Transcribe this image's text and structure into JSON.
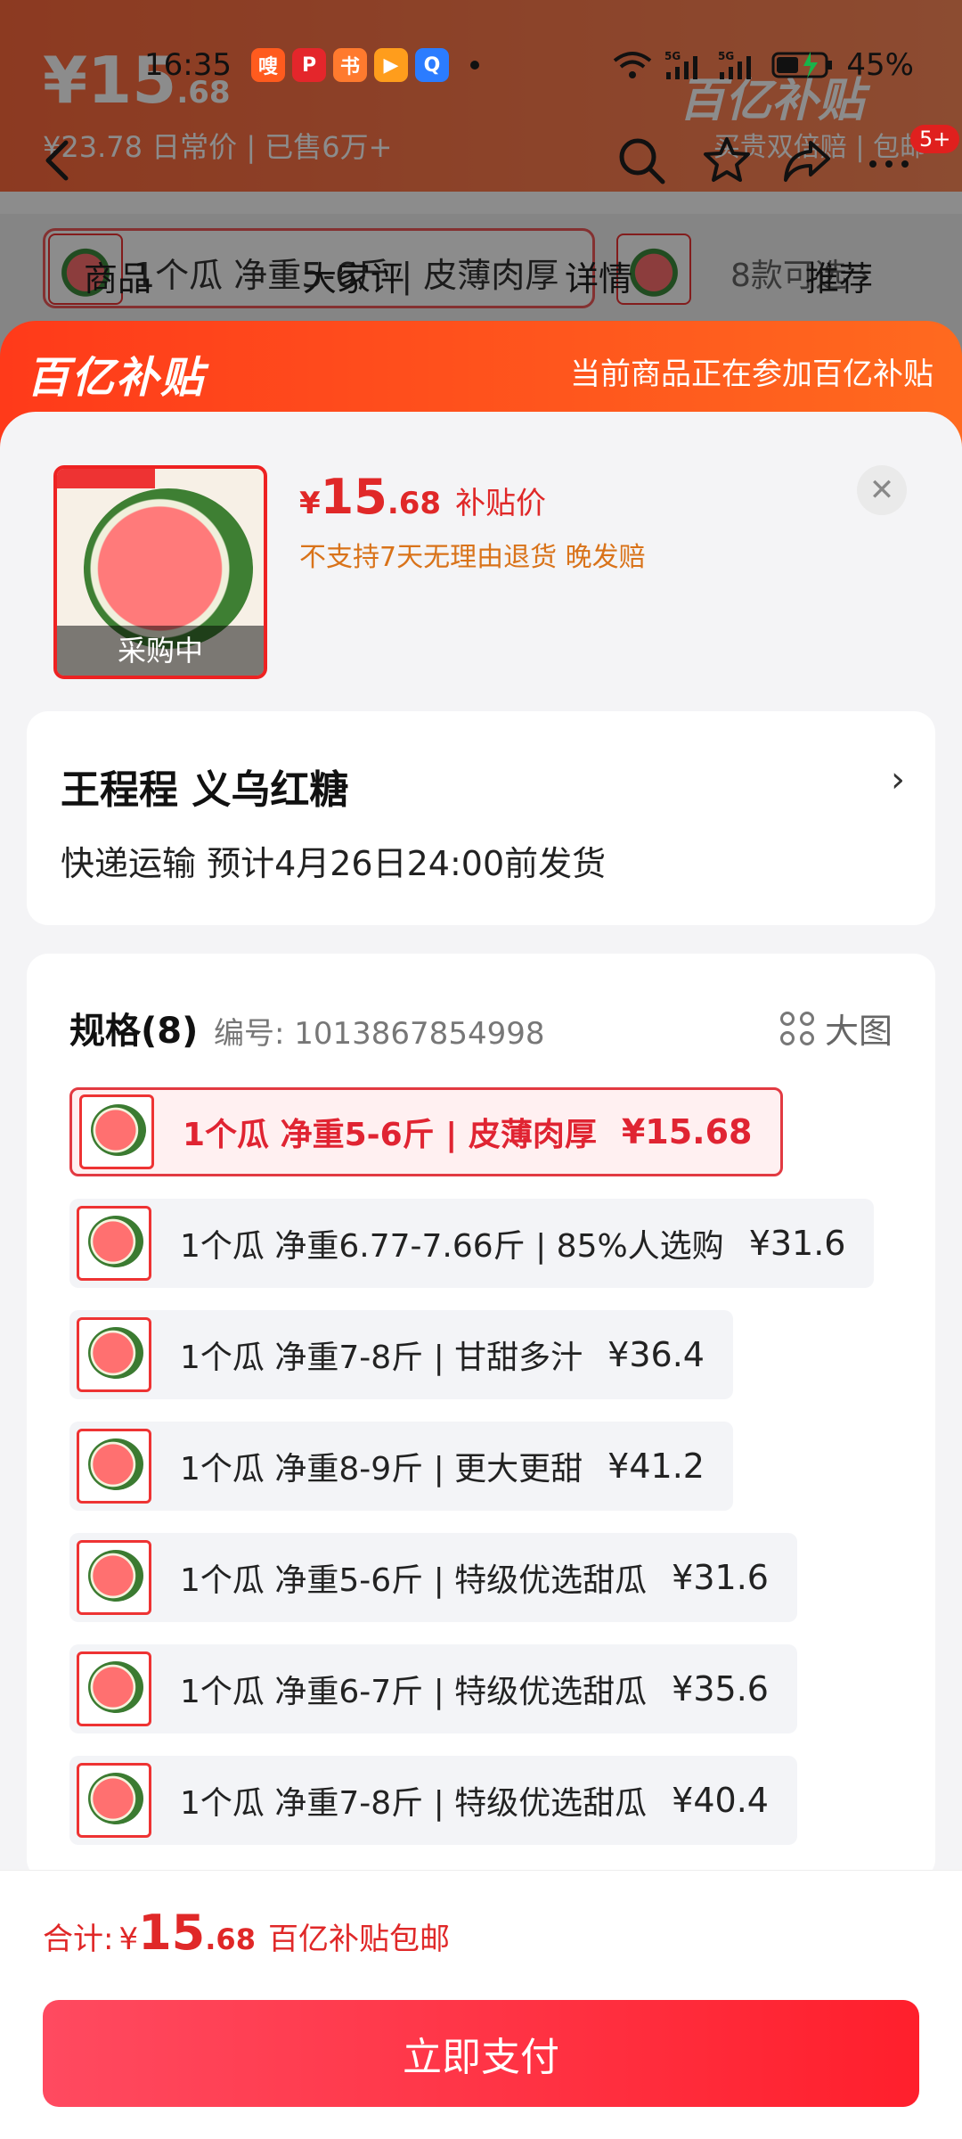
{
  "status_bar": {
    "time": "16:35",
    "battery": "45%",
    "apps": [
      {
        "icon": "app-red-icon",
        "color": "#ff5b1e",
        "glyph": "嗖"
      },
      {
        "icon": "app-reader-icon",
        "color": "#e4262b",
        "glyph": "P"
      },
      {
        "icon": "app-book-icon",
        "color": "#ff7a2e",
        "glyph": "书"
      },
      {
        "icon": "app-video-icon",
        "color": "#ff9d1c",
        "glyph": "▶"
      },
      {
        "icon": "app-search-icon",
        "color": "#2b7cff",
        "glyph": "Q"
      }
    ]
  },
  "background": {
    "price_int": "15",
    "price_dec": ".68",
    "sub": "¥23.78 日常价 | 已售6万+",
    "brand": "百亿补贴",
    "brand_sub": "买贵双倍赔 | 包邮",
    "sku_text": "1个瓜 净重5-6斤 | 皮薄肉厚",
    "more": "8款可选 ›"
  },
  "nav": {
    "badge": "5+",
    "tabs": [
      "商品",
      "大家评",
      "详情",
      "推荐"
    ]
  },
  "sheet": {
    "logo": "百亿补贴",
    "note": "当前商品正在参加百亿补贴",
    "product": {
      "overlay": "采购中",
      "currency": "¥",
      "price_int": "15",
      "price_dec": ".68",
      "price_label": "补贴价",
      "policy": "不支持7天无理由退货  晚发赔"
    },
    "address": {
      "name": "王程程  义乌红糖",
      "shipping": "快递运输 预计4月26日24:00前发货"
    },
    "spec": {
      "title": "规格(8)",
      "code": "编号: 1013867854998",
      "big_label": "大图",
      "items": [
        {
          "text": "1个瓜 净重5-6斤 | 皮薄肉厚",
          "price": "¥15.68",
          "selected": true
        },
        {
          "text": "1个瓜 净重6.77-7.66斤 | 85%人选购",
          "price": "¥31.6"
        },
        {
          "text": "1个瓜 净重7-8斤 | 甘甜多汁",
          "price": "¥36.4"
        },
        {
          "text": "1个瓜 净重8-9斤 | 更大更甜",
          "price": "¥41.2"
        },
        {
          "text": "1个瓜 净重5-6斤 | 特级优选甜瓜",
          "price": "¥31.6"
        },
        {
          "text": "1个瓜 净重6-7斤 | 特级优选甜瓜",
          "price": "¥35.6"
        },
        {
          "text": "1个瓜 净重7-8斤 | 特级优选甜瓜",
          "price": "¥40.4"
        }
      ]
    },
    "total": {
      "label": "合计:",
      "currency": "¥",
      "int": "15",
      "dec": ".68",
      "note": "百亿补贴包邮"
    },
    "pay_label": "立即支付"
  },
  "colors": {
    "accent": "#ff3a1a",
    "price_red": "#e02828",
    "pay_button": "#ff2a3a"
  }
}
